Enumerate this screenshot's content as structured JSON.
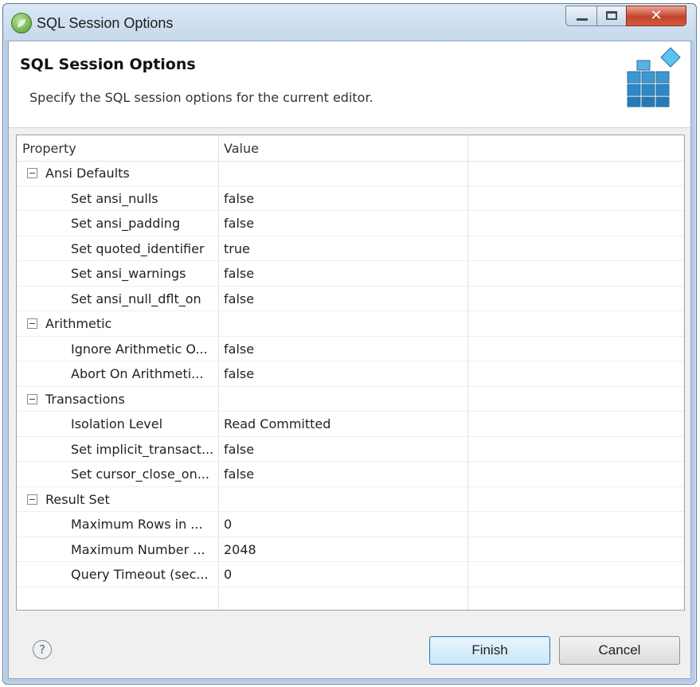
{
  "window": {
    "title": "SQL Session Options",
    "app_icon": "eclipse-leaf-icon",
    "controls": {
      "minimize": "minimize-icon",
      "maximize": "maximize-icon",
      "close": "✕"
    }
  },
  "banner": {
    "title": "SQL Session Options",
    "description": "Specify the SQL session options for the current editor.",
    "graphic": "database-blocks-icon"
  },
  "table": {
    "columns": [
      "Property",
      "Value",
      ""
    ],
    "rows": [
      {
        "kind": "group",
        "property": "Ansi Defaults",
        "value": ""
      },
      {
        "kind": "child",
        "property": "Set ansi_nulls",
        "value": "false"
      },
      {
        "kind": "child",
        "property": "Set ansi_padding",
        "value": "false"
      },
      {
        "kind": "child",
        "property": "Set quoted_identifier",
        "value": "true"
      },
      {
        "kind": "child",
        "property": "Set ansi_warnings",
        "value": "false"
      },
      {
        "kind": "child",
        "property": "Set ansi_null_dflt_on",
        "value": "false"
      },
      {
        "kind": "group",
        "property": "Arithmetic",
        "value": ""
      },
      {
        "kind": "child",
        "property": "Ignore Arithmetic O...",
        "value": "false"
      },
      {
        "kind": "child",
        "property": "Abort On Arithmeti...",
        "value": "false"
      },
      {
        "kind": "group",
        "property": "Transactions",
        "value": ""
      },
      {
        "kind": "child",
        "property": "Isolation Level",
        "value": "Read Committed"
      },
      {
        "kind": "child",
        "property": "Set implicit_transact...",
        "value": "false"
      },
      {
        "kind": "child",
        "property": "Set cursor_close_on...",
        "value": "false"
      },
      {
        "kind": "group",
        "property": "Result Set",
        "value": ""
      },
      {
        "kind": "child",
        "property": "Maximum Rows in ...",
        "value": "0"
      },
      {
        "kind": "child",
        "property": "Maximum Number ...",
        "value": "2048"
      },
      {
        "kind": "child",
        "property": "Query Timeout (sec...",
        "value": "0"
      }
    ]
  },
  "footer": {
    "help_icon": "?",
    "finish_label": "Finish",
    "cancel_label": "Cancel"
  },
  "colors": {
    "window_frame": "#b7cde6",
    "finish_button": "#c9e7f8",
    "close_button": "#c4442b"
  }
}
